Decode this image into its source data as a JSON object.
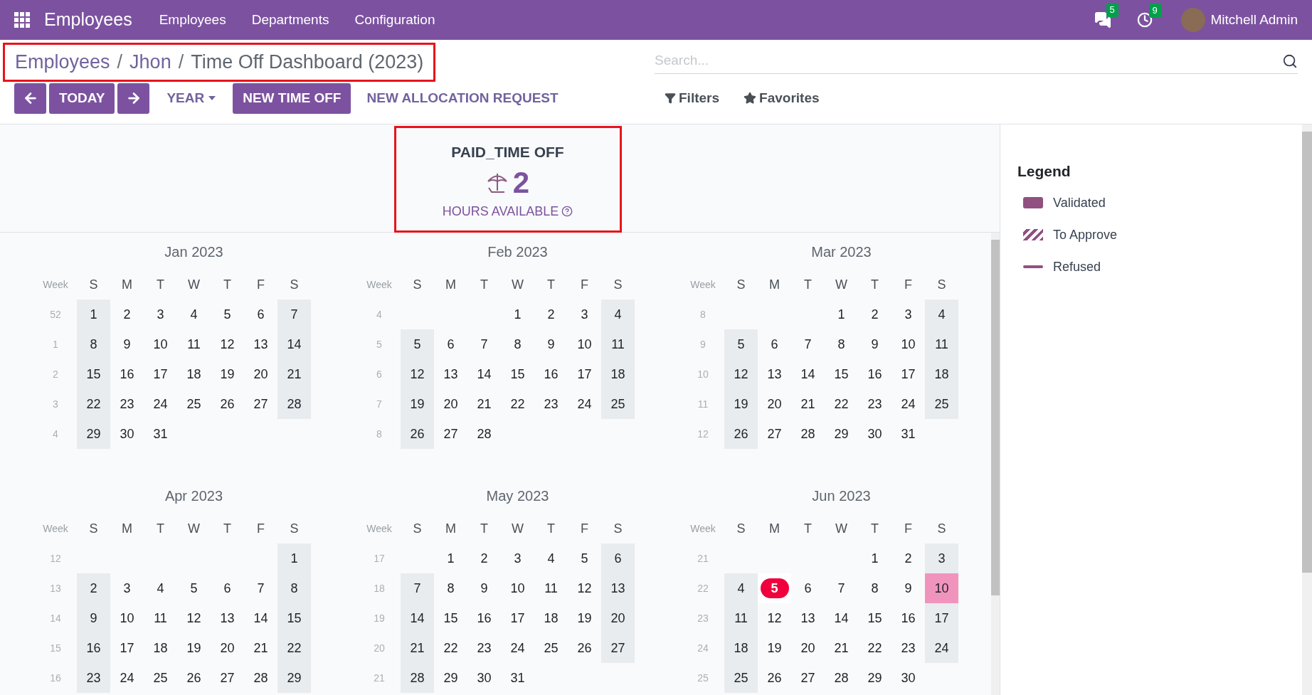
{
  "navbar": {
    "app_title": "Employees",
    "menu": [
      "Employees",
      "Departments",
      "Configuration"
    ],
    "messages_count": "5",
    "activities_count": "9",
    "user": "Mitchell Admin"
  },
  "breadcrumb": {
    "links": [
      {
        "label": "Employees",
        "separator": "/"
      },
      {
        "label": "Jhon",
        "separator": "/"
      }
    ],
    "current": "Time Off Dashboard (2023)"
  },
  "search": {
    "placeholder": "Search..."
  },
  "toolbar": {
    "today": "TODAY",
    "scale": "YEAR",
    "new_time_off": "NEW TIME OFF",
    "new_allocation": "NEW ALLOCATION REQUEST"
  },
  "search_options": [
    "Filters",
    "Favorites"
  ],
  "balance": {
    "type": "PAID_TIME OFF",
    "amount": "2",
    "unit": "HOURS AVAILABLE"
  },
  "months": [
    {
      "title": "Jan 2023",
      "week_label": "Week",
      "weekdays": [
        "S",
        "M",
        "T",
        "W",
        "T",
        "F",
        "S"
      ],
      "weeks": [
        {
          "week": "52",
          "days": {
            "sun": "1",
            "mon": "2",
            "tue": "3",
            "wed": "4",
            "thu": "5",
            "fri": "6",
            "sat": "7"
          }
        },
        {
          "week": "1",
          "days": {
            "sun": "8",
            "mon": "9",
            "tue": "10",
            "wed": "11",
            "thu": "12",
            "fri": "13",
            "sat": "14"
          }
        },
        {
          "week": "2",
          "days": {
            "sun": "15",
            "mon": "16",
            "tue": "17",
            "wed": "18",
            "thu": "19",
            "fri": "20",
            "sat": "21"
          }
        },
        {
          "week": "3",
          "days": {
            "sun": "22",
            "mon": "23",
            "tue": "24",
            "wed": "25",
            "thu": "26",
            "fri": "27",
            "sat": "28"
          }
        },
        {
          "week": "4",
          "days": {
            "sun": "29",
            "mon": "30",
            "tue": "31"
          }
        }
      ]
    },
    {
      "title": "Feb 2023",
      "week_label": "Week",
      "weekdays": [
        "S",
        "M",
        "T",
        "W",
        "T",
        "F",
        "S"
      ],
      "weeks": [
        {
          "week": "4",
          "days": {
            "wed": "1",
            "thu": "2",
            "fri": "3",
            "sat": "4"
          }
        },
        {
          "week": "5",
          "days": {
            "sun": "5",
            "mon": "6",
            "tue": "7",
            "wed": "8",
            "thu": "9",
            "fri": "10",
            "sat": "11"
          }
        },
        {
          "week": "6",
          "days": {
            "sun": "12",
            "mon": "13",
            "tue": "14",
            "wed": "15",
            "thu": "16",
            "fri": "17",
            "sat": "18"
          }
        },
        {
          "week": "7",
          "days": {
            "sun": "19",
            "mon": "20",
            "tue": "21",
            "wed": "22",
            "thu": "23",
            "fri": "24",
            "sat": "25"
          }
        },
        {
          "week": "8",
          "days": {
            "sun": "26",
            "mon": "27",
            "tue": "28"
          }
        }
      ]
    },
    {
      "title": "Mar 2023",
      "week_label": "Week",
      "weekdays": [
        "S",
        "M",
        "T",
        "W",
        "T",
        "F",
        "S"
      ],
      "weeks": [
        {
          "week": "8",
          "days": {
            "wed": "1",
            "thu": "2",
            "fri": "3",
            "sat": "4"
          }
        },
        {
          "week": "9",
          "days": {
            "sun": "5",
            "mon": "6",
            "tue": "7",
            "wed": "8",
            "thu": "9",
            "fri": "10",
            "sat": "11"
          }
        },
        {
          "week": "10",
          "days": {
            "sun": "12",
            "mon": "13",
            "tue": "14",
            "wed": "15",
            "thu": "16",
            "fri": "17",
            "sat": "18"
          }
        },
        {
          "week": "11",
          "days": {
            "sun": "19",
            "mon": "20",
            "tue": "21",
            "wed": "22",
            "thu": "23",
            "fri": "24",
            "sat": "25"
          }
        },
        {
          "week": "12",
          "days": {
            "sun": "26",
            "mon": "27",
            "tue": "28",
            "wed": "29",
            "thu": "30",
            "fri": "31"
          }
        }
      ]
    },
    {
      "title": "Apr 2023",
      "week_label": "Week",
      "weekdays": [
        "S",
        "M",
        "T",
        "W",
        "T",
        "F",
        "S"
      ],
      "weeks": [
        {
          "week": "12",
          "days": {
            "sat": "1"
          }
        },
        {
          "week": "13",
          "days": {
            "sun": "2",
            "mon": "3",
            "tue": "4",
            "wed": "5",
            "thu": "6",
            "fri": "7",
            "sat": "8"
          }
        },
        {
          "week": "14",
          "days": {
            "sun": "9",
            "mon": "10",
            "tue": "11",
            "wed": "12",
            "thu": "13",
            "fri": "14",
            "sat": "15"
          }
        },
        {
          "week": "15",
          "days": {
            "sun": "16",
            "mon": "17",
            "tue": "18",
            "wed": "19",
            "thu": "20",
            "fri": "21",
            "sat": "22"
          }
        },
        {
          "week": "16",
          "days": {
            "sun": "23",
            "mon": "24",
            "tue": "25",
            "wed": "26",
            "thu": "27",
            "fri": "28",
            "sat": "29"
          }
        }
      ]
    },
    {
      "title": "May 2023",
      "week_label": "Week",
      "weekdays": [
        "S",
        "M",
        "T",
        "W",
        "T",
        "F",
        "S"
      ],
      "weeks": [
        {
          "week": "17",
          "days": {
            "mon": "1",
            "tue": "2",
            "wed": "3",
            "thu": "4",
            "fri": "5",
            "sat": "6"
          }
        },
        {
          "week": "18",
          "days": {
            "sun": "7",
            "mon": "8",
            "tue": "9",
            "wed": "10",
            "thu": "11",
            "fri": "12",
            "sat": "13"
          }
        },
        {
          "week": "19",
          "days": {
            "sun": "14",
            "mon": "15",
            "tue": "16",
            "wed": "17",
            "thu": "18",
            "fri": "19",
            "sat": "20"
          }
        },
        {
          "week": "20",
          "days": {
            "sun": "21",
            "mon": "22",
            "tue": "23",
            "wed": "24",
            "thu": "25",
            "fri": "26",
            "sat": "27"
          }
        },
        {
          "week": "21",
          "days": {
            "sun": "28",
            "mon": "29",
            "tue": "30",
            "wed": "31"
          }
        }
      ]
    },
    {
      "title": "Jun 2023",
      "week_label": "Week",
      "weekdays": [
        "S",
        "M",
        "T",
        "W",
        "T",
        "F",
        "S"
      ],
      "weeks": [
        {
          "week": "21",
          "days": {
            "thu": "1",
            "fri": "2",
            "sat": "3"
          }
        },
        {
          "week": "22",
          "days": {
            "sun": "4",
            "mon": {
              "day": "5",
              "kind": "today"
            },
            "tue": "6",
            "wed": "7",
            "thu": "8",
            "fri": "9",
            "sat": {
              "day": "10",
              "kind": "leave",
              "color": "#f194bd"
            }
          }
        },
        {
          "week": "23",
          "days": {
            "sun": "11",
            "mon": "12",
            "tue": "13",
            "wed": "14",
            "thu": "15",
            "fri": "16",
            "sat": "17"
          }
        },
        {
          "week": "24",
          "days": {
            "sun": "18",
            "mon": "19",
            "tue": "20",
            "wed": "21",
            "thu": "22",
            "fri": "23",
            "sat": "24"
          }
        },
        {
          "week": "25",
          "days": {
            "sun": "25",
            "mon": "26",
            "tue": "27",
            "wed": "28",
            "thu": "29",
            "fri": "30"
          }
        }
      ]
    }
  ],
  "legend": {
    "title": "Legend",
    "items": [
      {
        "label": "Validated",
        "kind": "solid",
        "color": "#91507f"
      },
      {
        "label": "To Approve",
        "kind": "hatched",
        "color": "#91507f"
      },
      {
        "label": "Refused",
        "kind": "line",
        "color": "#91507f"
      }
    ]
  }
}
